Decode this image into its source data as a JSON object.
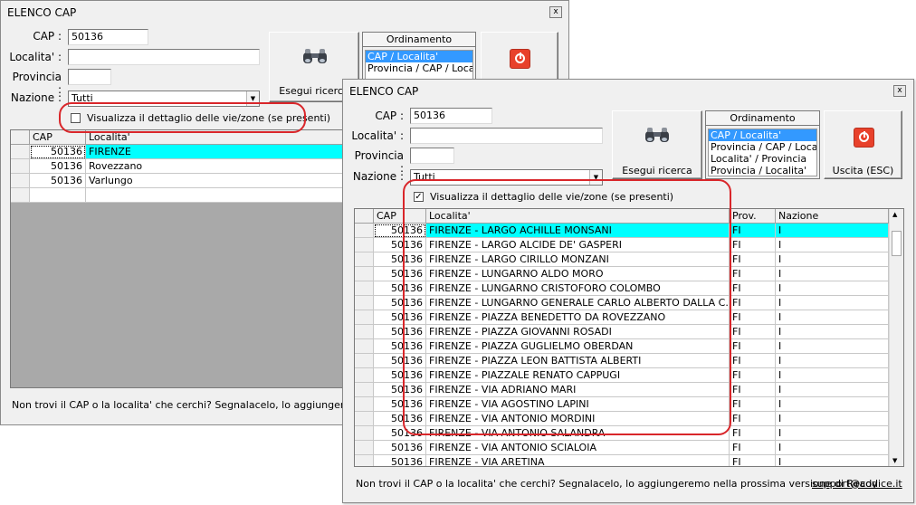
{
  "back_window": {
    "title": "ELENCO CAP",
    "cap_label": "CAP :",
    "cap_value": "50136",
    "localita_label": "Localita' :",
    "localita_value": "",
    "provincia_label": "Provincia :",
    "provincia_value": "",
    "nazione_label": "Nazione :",
    "nazione_value": "Tutti",
    "search_button": "Esegui ricerca",
    "ordinamento_header": "Ordinamento",
    "ordinamento_options": [
      "CAP / Localita'",
      "Provincia / CAP / Localit"
    ],
    "checkbox_label": "Visualizza il dettaglio delle vie/zone (se presenti)",
    "checkbox_checked": false,
    "grid": {
      "headers": [
        "CAP",
        "Localita'"
      ],
      "rows": [
        [
          "50136",
          "FIRENZE"
        ],
        [
          "50136",
          "Rovezzano"
        ],
        [
          "50136",
          "Varlungo"
        ]
      ]
    },
    "footer": "Non trovi il CAP o la localita' che cerchi? Segnalacelo, lo aggiungeremo nella"
  },
  "front_window": {
    "title": "ELENCO CAP",
    "close_label": "x",
    "cap_label": "CAP :",
    "cap_value": "50136",
    "localita_label": "Localita' :",
    "localita_value": "",
    "provincia_label": "Provincia :",
    "provincia_value": "",
    "nazione_label": "Nazione :",
    "nazione_value": "Tutti",
    "search_button": "Esegui ricerca",
    "exit_button": "Uscita (ESC)",
    "ordinamento_header": "Ordinamento",
    "ordinamento_options": [
      "CAP / Localita'",
      "Provincia / CAP / Localit",
      "Localita' / Provincia",
      "Provincia / Localita'"
    ],
    "checkbox_label": "Visualizza il dettaglio delle vie/zone (se presenti)",
    "checkbox_checked": true,
    "grid": {
      "headers": [
        "CAP",
        "Localita'",
        "Prov.",
        "Nazione"
      ],
      "rows": [
        [
          "50136",
          "FIRENZE - LARGO ACHILLE MONSANI",
          "FI",
          "I"
        ],
        [
          "50136",
          "FIRENZE - LARGO ALCIDE DE' GASPERI",
          "FI",
          "I"
        ],
        [
          "50136",
          "FIRENZE - LARGO CIRILLO MONZANI",
          "FI",
          "I"
        ],
        [
          "50136",
          "FIRENZE - LUNGARNO ALDO MORO",
          "FI",
          "I"
        ],
        [
          "50136",
          "FIRENZE - LUNGARNO CRISTOFORO COLOMBO",
          "FI",
          "I"
        ],
        [
          "50136",
          "FIRENZE - LUNGARNO GENERALE CARLO ALBERTO DALLA C...",
          "FI",
          "I"
        ],
        [
          "50136",
          "FIRENZE - PIAZZA BENEDETTO DA ROVEZZANO",
          "FI",
          "I"
        ],
        [
          "50136",
          "FIRENZE - PIAZZA GIOVANNI ROSADI",
          "FI",
          "I"
        ],
        [
          "50136",
          "FIRENZE - PIAZZA GUGLIELMO OBERDAN",
          "FI",
          "I"
        ],
        [
          "50136",
          "FIRENZE - PIAZZA LEON BATTISTA ALBERTI",
          "FI",
          "I"
        ],
        [
          "50136",
          "FIRENZE - PIAZZALE RENATO CAPPUGI",
          "FI",
          "I"
        ],
        [
          "50136",
          "FIRENZE - VIA ADRIANO MARI",
          "FI",
          "I"
        ],
        [
          "50136",
          "FIRENZE - VIA AGOSTINO LAPINI",
          "FI",
          "I"
        ],
        [
          "50136",
          "FIRENZE - VIA ANTONIO MORDINI",
          "FI",
          "I"
        ],
        [
          "50136",
          "FIRENZE - VIA ANTONIO SALANDRA",
          "FI",
          "I"
        ],
        [
          "50136",
          "FIRENZE - VIA ANTONIO SCIALOIA",
          "FI",
          "I"
        ],
        [
          "50136",
          "FIRENZE - VIA ARETINA",
          "FI",
          "I"
        ]
      ]
    },
    "footer": "Non trovi il CAP o la localita' che cerchi? Segnalacelo, lo aggiungeremo nella prossima versione di Ready",
    "support_link": "support@codice.it"
  },
  "colors": {
    "selection_row": "#00ffff",
    "list_selection": "#3399ff",
    "annotation_red": "#d9262a",
    "exit_icon": "#e8412b"
  },
  "icons": [
    "binoculars-icon",
    "power-icon",
    "close-icon",
    "dropdown-arrow-icon",
    "scroll-up-icon",
    "scroll-down-icon"
  ]
}
